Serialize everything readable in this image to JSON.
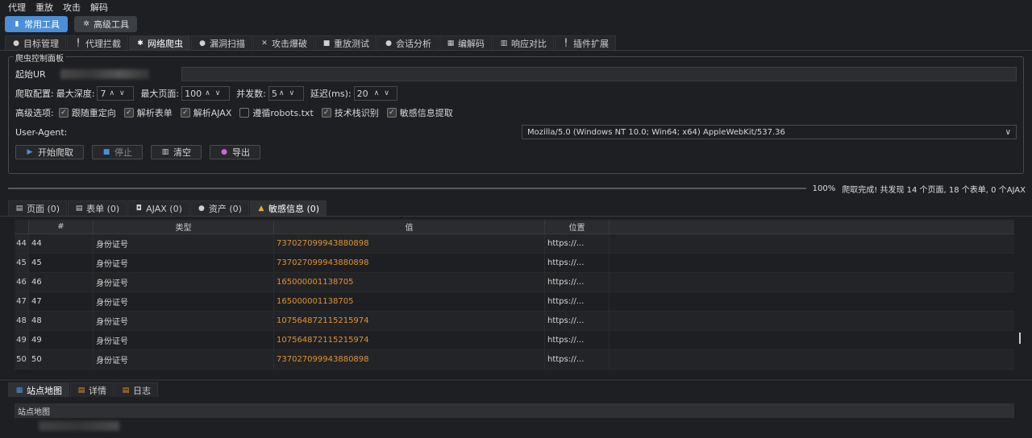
{
  "menu": [
    "代理",
    "重放",
    "攻击",
    "解码"
  ],
  "modes": [
    {
      "label": "常用工具",
      "icon": "mug-icon"
    },
    {
      "label": "高级工具",
      "icon": "gear-icon"
    }
  ],
  "main_tabs": [
    {
      "label": "目标管理",
      "icon": "target-icon",
      "glyph": "●"
    },
    {
      "label": "代理拦截",
      "icon": "pin-icon",
      "glyph": "╿"
    },
    {
      "label": "网络爬虫",
      "icon": "spider-icon",
      "glyph": "✱"
    },
    {
      "label": "漏洞扫描",
      "icon": "magnifier-icon",
      "glyph": "●"
    },
    {
      "label": "攻击爆破",
      "icon": "swords-icon",
      "glyph": "✕"
    },
    {
      "label": "重放测试",
      "icon": "replay-icon",
      "glyph": "■"
    },
    {
      "label": "会话分析",
      "icon": "session-icon",
      "glyph": "●"
    },
    {
      "label": "编解码",
      "icon": "codec-icon",
      "glyph": "▦"
    },
    {
      "label": "响应对比",
      "icon": "compare-icon",
      "glyph": "▥"
    },
    {
      "label": "插件扩展",
      "icon": "plugin-icon",
      "glyph": "╿"
    }
  ],
  "crawler": {
    "panel_title": "爬虫控制面板",
    "start_url_label": "起始UR",
    "config_label": "爬取配置:",
    "max_depth_label": "最大深度:",
    "max_depth_value": "7",
    "max_pages_label": "最大页面:",
    "max_pages_value": "1000",
    "concurrency_label": "并发数:",
    "concurrency_value": "5",
    "delay_label": "延迟(ms):",
    "delay_value": "20",
    "advanced_label": "高级选项:",
    "options": [
      {
        "label": "跟随重定向",
        "checked": true
      },
      {
        "label": "解析表单",
        "checked": true
      },
      {
        "label": "解析AJAX",
        "checked": true
      },
      {
        "label": "遵循robots.txt",
        "checked": false
      },
      {
        "label": "技术栈识别",
        "checked": true
      },
      {
        "label": "敏感信息提取",
        "checked": true
      }
    ],
    "ua_label": "User-Agent:",
    "ua_value": "Mozilla/5.0 (Windows NT 10.0; Win64; x64) AppleWebKit/537.36",
    "buttons": {
      "start": "开始爬取",
      "stop": "停止",
      "clear": "清空",
      "export": "导出"
    }
  },
  "progress": {
    "percent": 100,
    "percent_text": "100%",
    "status": "爬取完成! 共发现 14 个页面, 18 个表单, 0 个AJAX"
  },
  "result_tabs": [
    {
      "label": "页面 (0)",
      "icon": "page-icon",
      "glyph": "▤"
    },
    {
      "label": "表单 (0)",
      "icon": "form-icon",
      "glyph": "▤"
    },
    {
      "label": "AJAX (0)",
      "icon": "ajax-icon",
      "glyph": "◘"
    },
    {
      "label": "资产 (0)",
      "icon": "asset-icon",
      "glyph": "●"
    },
    {
      "label": "敏感信息 (0)",
      "icon": "warning-icon",
      "glyph": "▲"
    }
  ],
  "table": {
    "headers": [
      "#",
      "类型",
      "值",
      "位置"
    ],
    "rows": [
      {
        "n": "44",
        "id": "44",
        "type": "身份证号",
        "value": "737027099943880898",
        "loc": "https://..."
      },
      {
        "n": "45",
        "id": "45",
        "type": "身份证号",
        "value": "737027099943880898",
        "loc": "https://..."
      },
      {
        "n": "46",
        "id": "46",
        "type": "身份证号",
        "value": "165000001138705",
        "loc": "https://..."
      },
      {
        "n": "47",
        "id": "47",
        "type": "身份证号",
        "value": "165000001138705",
        "loc": "https://..."
      },
      {
        "n": "48",
        "id": "48",
        "type": "身份证号",
        "value": "107564872115215974",
        "loc": "https://..."
      },
      {
        "n": "49",
        "id": "49",
        "type": "身份证号",
        "value": "107564872115215974",
        "loc": "https://..."
      },
      {
        "n": "50",
        "id": "50",
        "type": "身份证号",
        "value": "737027099943880898",
        "loc": "https://..."
      }
    ]
  },
  "bottom_tabs": [
    {
      "label": "站点地图",
      "icon": "sitemap-icon",
      "glyph": "▦"
    },
    {
      "label": "详情",
      "icon": "detail-icon",
      "glyph": "▤"
    },
    {
      "label": "日志",
      "icon": "log-icon",
      "glyph": "▤"
    }
  ],
  "sitemap_header": "站点地图",
  "colors": {
    "accent": "#4a8fd8",
    "value": "#e0932d",
    "warning": "#e8b22a"
  }
}
